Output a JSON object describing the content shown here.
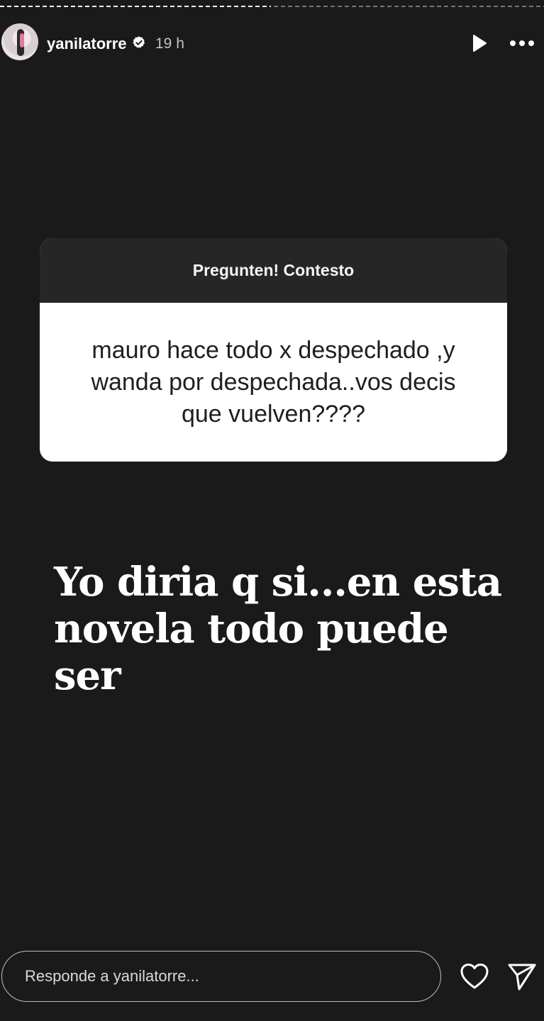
{
  "progress": {
    "segments": [
      {
        "state": "done"
      },
      {
        "state": "pending"
      }
    ]
  },
  "header": {
    "username": "yanilatorre",
    "time": "19 h",
    "verified": true,
    "avatar_icon": "profile-avatar",
    "play_icon": "play-icon",
    "more_icon": "more-options-icon"
  },
  "question": {
    "title": "Pregunten! Contesto",
    "text": "mauro hace todo x despechado ,y wanda por despechada..vos decis que vuelven????"
  },
  "answer": {
    "line1": "Yo diria q si...en esta",
    "line2": "novela todo puede ser"
  },
  "reply": {
    "placeholder": "Responde a yanilatorre..."
  },
  "actions": {
    "like_icon": "heart-icon",
    "send_icon": "send-icon"
  },
  "colors": {
    "background": "#1a1a1a",
    "card_header": "#262626",
    "card_body": "#ffffff",
    "text_primary": "#ffffff",
    "text_muted": "#c4c4c4"
  }
}
